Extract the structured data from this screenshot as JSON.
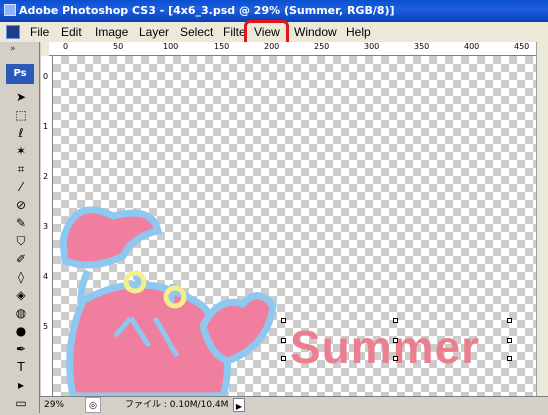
{
  "window": {
    "title": "Adobe Photoshop CS3 - [4x6_3.psd @ 29% (Summer, RGB/8)]"
  },
  "menu": {
    "items": [
      {
        "id": "file",
        "label": "File"
      },
      {
        "id": "edit",
        "label": "Edit"
      },
      {
        "id": "image",
        "label": "Image"
      },
      {
        "id": "layer",
        "label": "Layer"
      },
      {
        "id": "select",
        "label": "Select"
      },
      {
        "id": "filter",
        "label": "Filter"
      },
      {
        "id": "view",
        "label": "View"
      },
      {
        "id": "window",
        "label": "Window"
      },
      {
        "id": "help",
        "label": "Help"
      }
    ],
    "highlighted_item": "view"
  },
  "toolbox": {
    "badge": "Ps",
    "collapse": "»",
    "tools": [
      {
        "name": "move-tool-icon",
        "glyph": "➤"
      },
      {
        "name": "marquee-tool-icon",
        "glyph": "⬚"
      },
      {
        "name": "lasso-tool-icon",
        "glyph": "ℓ"
      },
      {
        "name": "magic-wand-tool-icon",
        "glyph": "✶"
      },
      {
        "name": "crop-tool-icon",
        "glyph": "⌗"
      },
      {
        "name": "slice-tool-icon",
        "glyph": "⁄"
      },
      {
        "name": "healing-brush-tool-icon",
        "glyph": "⊘"
      },
      {
        "name": "brush-tool-icon",
        "glyph": "✎"
      },
      {
        "name": "clone-stamp-tool-icon",
        "glyph": "⛉"
      },
      {
        "name": "history-brush-tool-icon",
        "glyph": "✐"
      },
      {
        "name": "eraser-tool-icon",
        "glyph": "◊"
      },
      {
        "name": "paint-bucket-tool-icon",
        "glyph": "◈"
      },
      {
        "name": "blur-tool-icon",
        "glyph": "◍"
      },
      {
        "name": "dodge-tool-icon",
        "glyph": "●"
      },
      {
        "name": "pen-tool-icon",
        "glyph": "✒"
      },
      {
        "name": "type-tool-icon",
        "glyph": "T"
      },
      {
        "name": "path-selection-tool-icon",
        "glyph": "▸"
      },
      {
        "name": "shape-tool-icon",
        "glyph": "▭"
      }
    ]
  },
  "rulers": {
    "top_labels": [
      "0",
      "50",
      "100",
      "150",
      "200",
      "250",
      "300",
      "350",
      "400",
      "450"
    ],
    "left_labels": [
      "0",
      "1",
      "2",
      "3",
      "4",
      "5"
    ]
  },
  "document": {
    "layer_text": "Summer",
    "colors": {
      "text": "#e97f8f",
      "crab_body": "#f07f9f",
      "crab_outline": "#8ec8f0",
      "crab_eye": "#f3f08c"
    }
  },
  "status": {
    "zoom": "29%",
    "doc_info": "ファイル : 0.10M/10.4M",
    "nav_icon": "◎",
    "arrow": "▶"
  }
}
